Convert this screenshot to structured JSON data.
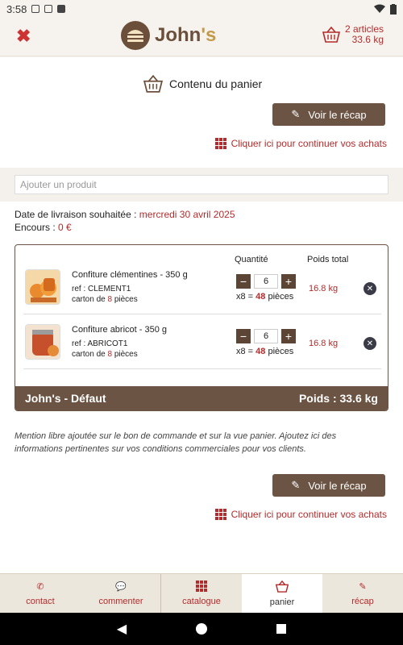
{
  "status_bar": {
    "time": "3:58",
    "icons_left": [
      "a-icon",
      "s-icon",
      "save-icon"
    ],
    "icons_right": [
      "wifi-icon",
      "battery-icon"
    ]
  },
  "header": {
    "brand_main": "John",
    "brand_suffix": "'s",
    "cart_count": "2 articles",
    "cart_weight": "33.6 kg"
  },
  "section": {
    "title": "Contenu du panier",
    "recap_button": "Voir le récap",
    "continue_link": "Cliquer ici pour continuer vos achats"
  },
  "search": {
    "placeholder": "Ajouter un produit"
  },
  "delivery": {
    "label": "Date de livraison souhaitée :",
    "date": "mercredi 30 avril 2025"
  },
  "encours": {
    "label": "Encours :",
    "value": "0 €"
  },
  "table": {
    "qty_header": "Quantité",
    "weight_header": "Poids total",
    "items": [
      {
        "name": "Confiture clémentines - 350 g",
        "ref_label": "ref :",
        "ref": "CLEMENT1",
        "carton_label": "carton de",
        "carton_count": "8",
        "carton_unit": "pièces",
        "qty": "6",
        "mult": "x8 =",
        "pieces": "48",
        "pieces_label": "pièces",
        "weight": "16.8 kg"
      },
      {
        "name": "Confiture abricot - 350 g",
        "ref_label": "ref :",
        "ref": "ABRICOT1",
        "carton_label": "carton de",
        "carton_count": "8",
        "carton_unit": "pièces",
        "qty": "6",
        "mult": "x8 =",
        "pieces": "48",
        "pieces_label": "pièces",
        "weight": "16.8 kg"
      }
    ],
    "footer_left": "John's - Défaut",
    "footer_right": "Poids : 33.6 kg"
  },
  "note": "Mention libre ajoutée sur le bon de commande et sur la vue panier. Ajoutez ici des informations pertinentes sur vos conditions commerciales pour vos clients.",
  "bottom_nav": [
    {
      "label": "contact",
      "icon": "phone-icon"
    },
    {
      "label": "commenter",
      "icon": "comment-icon"
    },
    {
      "label": "catalogue",
      "icon": "grid-icon"
    },
    {
      "label": "panier",
      "icon": "basket-icon"
    },
    {
      "label": "récap",
      "icon": "edit-icon"
    }
  ],
  "colors": {
    "brown": "#6b5443",
    "accent_red": "#b32b2b",
    "background": "#f6f3ee"
  }
}
